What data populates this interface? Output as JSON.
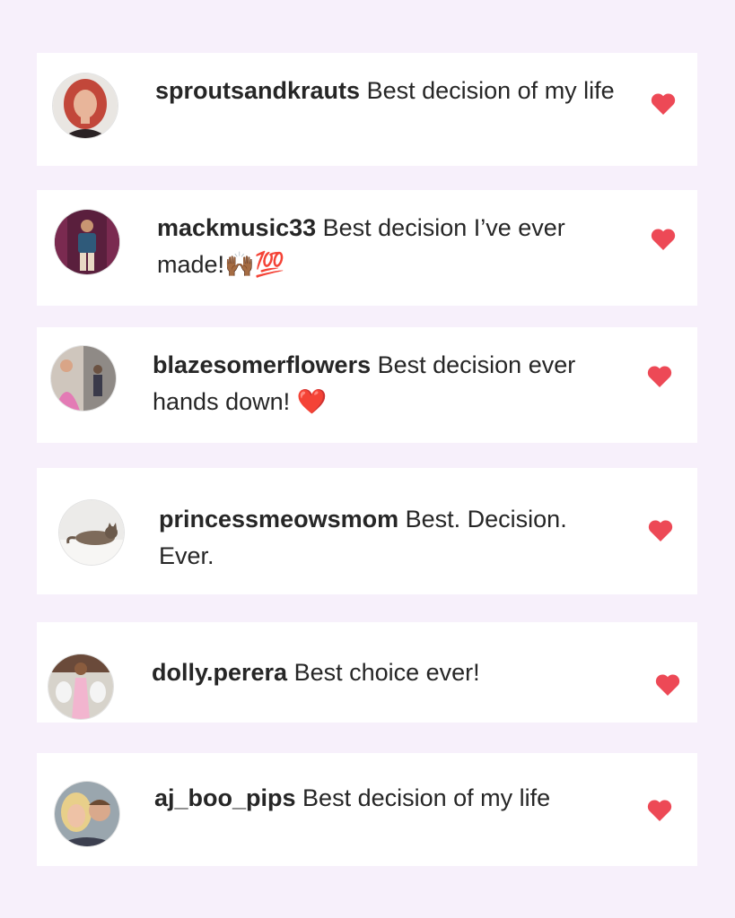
{
  "colors": {
    "page_background": "#f7f0fb",
    "card_background": "#ffffff",
    "text": "#262626",
    "heart": "#ed4956"
  },
  "comments": [
    {
      "username": "sproutsandkrauts",
      "text": "Best decision of my life",
      "liked": true,
      "avatar_icon": "woman-red-hair-avatar"
    },
    {
      "username": "mackmusic33",
      "text": "Best decision I’ve ever made!🙌🏾💯",
      "liked": true,
      "avatar_icon": "man-on-stage-avatar"
    },
    {
      "username": "blazesomerflowers",
      "text": "Best decision ever hands down! ❤️",
      "liked": true,
      "avatar_icon": "woman-collage-avatar"
    },
    {
      "username": "princessmeowsmom",
      "text": "Best. Decision. Ever.",
      "liked": true,
      "avatar_icon": "cat-on-bed-avatar"
    },
    {
      "username": "dolly.perera",
      "text": "Best choice ever!",
      "liked": true,
      "avatar_icon": "woman-with-dogs-avatar"
    },
    {
      "username": "aj_boo_pips",
      "text": "Best decision of my life",
      "liked": true,
      "avatar_icon": "couple-selfie-avatar"
    }
  ]
}
